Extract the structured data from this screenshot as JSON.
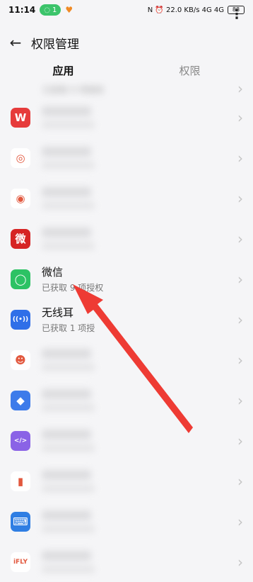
{
  "statusbar": {
    "time": "11:14",
    "hotspot_count": "1",
    "right_text": "N  ⏰  22.0 KB/s  4G  4G",
    "battery": "88"
  },
  "header": {
    "title": "权限管理",
    "back_icon": "arrow-left-icon",
    "more_icon": "more-vertical-icon"
  },
  "tabs": [
    {
      "label": "应用",
      "active": true
    },
    {
      "label": "权限",
      "active": false
    }
  ],
  "list": {
    "top_partial_sub": "已获取 9 项授权",
    "items": [
      {
        "name": "",
        "sub": "",
        "icon": "wps-office-icon",
        "color": "#e63b3b",
        "glyph": "W"
      },
      {
        "name": "",
        "sub": "",
        "icon": "colorful-ring-app-icon",
        "color": "#ffffff",
        "glyph": "◎"
      },
      {
        "name": "",
        "sub": "",
        "icon": "weibo-icon",
        "color": "#ffffff",
        "glyph": "◉"
      },
      {
        "name": "",
        "sub": "",
        "icon": "wei-red-app-icon",
        "color": "#d62424",
        "glyph": "微"
      },
      {
        "name": "微信",
        "sub": "已获取 9 项授权",
        "icon": "wechat-icon",
        "color": "#2cc264",
        "glyph": "◯"
      },
      {
        "name": "无线耳",
        "sub": "已获取 1 项授",
        "icon": "wireless-earphone-icon",
        "color": "#2f6fe8",
        "glyph": "((•))"
      },
      {
        "name": "",
        "sub": "",
        "icon": "yellow-bird-app-icon",
        "color": "#ffffff",
        "glyph": "☻"
      },
      {
        "name": "",
        "sub": "",
        "icon": "blue-tile-app-icon",
        "color": "#3d7bea",
        "glyph": "◆"
      },
      {
        "name": "",
        "sub": "",
        "icon": "code-editor-app-icon",
        "color": "#8a63e6",
        "glyph": "</>"
      },
      {
        "name": "",
        "sub": "",
        "icon": "red-box-app-icon",
        "color": "#ffffff",
        "glyph": "▮"
      },
      {
        "name": "",
        "sub": "",
        "icon": "blue-keyboard-app-icon",
        "color": "#2f7ee3",
        "glyph": "⌨"
      },
      {
        "name": "",
        "sub": "",
        "icon": "ifly-app-icon",
        "color": "#ffffff",
        "glyph": "iFLY"
      }
    ]
  },
  "chevron_icon": "chevron-right-icon",
  "annotation_arrow_color": "#ee3b34"
}
